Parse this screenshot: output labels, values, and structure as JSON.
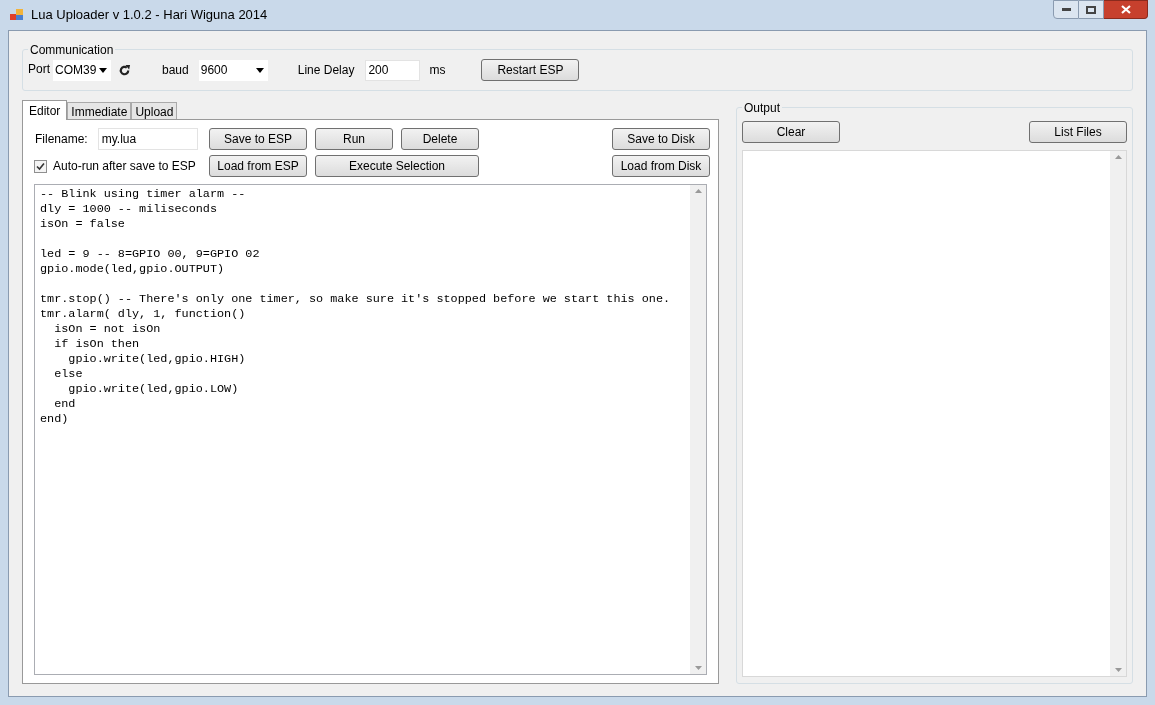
{
  "window": {
    "title": "Lua Uploader v 1.0.2 - Hari Wiguna 2014"
  },
  "communication": {
    "title": "Communication",
    "port_label": "Port",
    "port": "COM39",
    "baud_label": "baud",
    "baud": "9600",
    "line_delay_label": "Line Delay",
    "line_delay": "200",
    "line_delay_unit": "ms",
    "restart_button": "Restart ESP"
  },
  "tabs": [
    {
      "label": "Editor",
      "selected": true
    },
    {
      "label": "Immediate",
      "selected": false
    },
    {
      "label": "Upload",
      "selected": false
    }
  ],
  "editor": {
    "filename_label": "Filename:",
    "filename": "my.lua",
    "autorun": {
      "label": "Auto-run after save to ESP",
      "checked": true
    },
    "buttons_row1": [
      "Save to ESP",
      "Run",
      "Delete"
    ],
    "buttons_row2": [
      "Load from ESP",
      "Execute Selection"
    ],
    "disk_buttons": [
      "Save to Disk",
      "Load from Disk"
    ],
    "code": "-- Blink using timer alarm --\ndly = 1000 -- miliseconds\nisOn = false\n\nled = 9 -- 8=GPIO 00, 9=GPIO 02\ngpio.mode(led,gpio.OUTPUT)\n\ntmr.stop() -- There's only one timer, so make sure it's stopped before we start this one.\ntmr.alarm( dly, 1, function()\n  isOn = not isOn\n  if isOn then\n    gpio.write(led,gpio.HIGH)\n  else\n    gpio.write(led,gpio.LOW)\n  end\nend)"
  },
  "output": {
    "title": "Output",
    "clear_button": "Clear",
    "list_files_button": "List Files"
  }
}
